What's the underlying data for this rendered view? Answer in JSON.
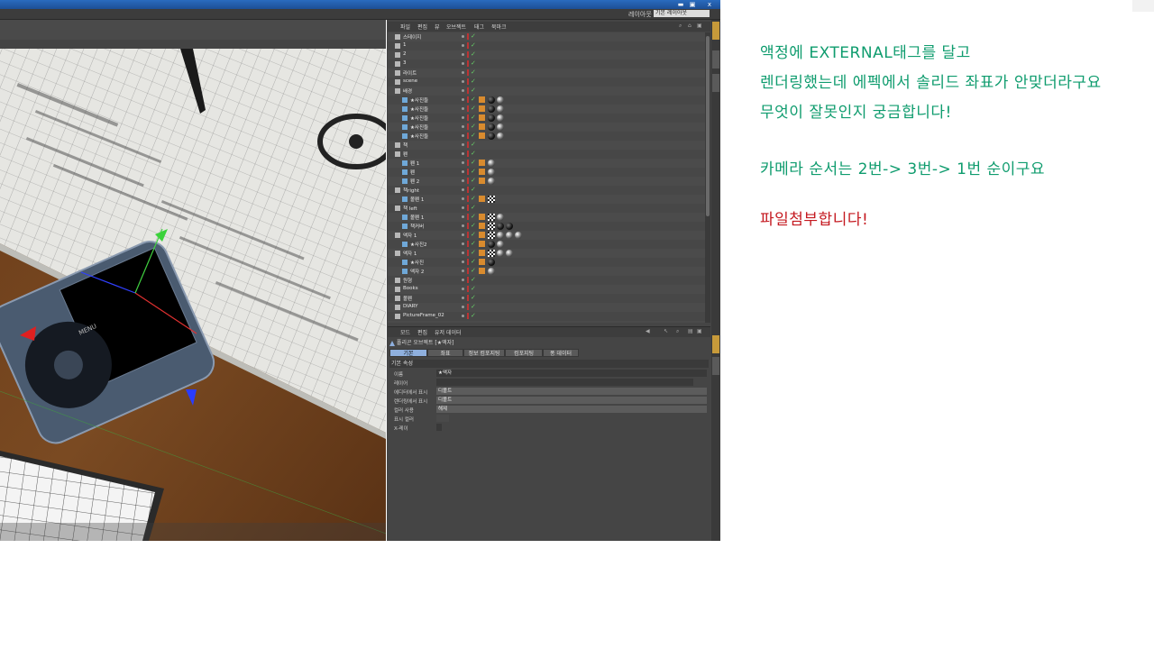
{
  "window": {
    "buttons": [
      "▬",
      "▣",
      "x"
    ],
    "layout_label": "레이아웃",
    "layout_value": "기본 레이아웃"
  },
  "viewport": {
    "device_menu_label": "MENU"
  },
  "object_manager": {
    "menu": [
      "파일",
      "편집",
      "뷰",
      "오브젝트",
      "태그",
      "북마크"
    ],
    "objects": [
      {
        "name": "스테이지",
        "indent": 0
      },
      {
        "name": "1",
        "indent": 0
      },
      {
        "name": "2",
        "indent": 0
      },
      {
        "name": "3",
        "indent": 0
      },
      {
        "name": "라이트",
        "indent": 0
      },
      {
        "name": "scene",
        "indent": 0
      },
      {
        "name": "배경",
        "indent": 0
      },
      {
        "name": "★사진들",
        "indent": 1
      },
      {
        "name": "★사진들",
        "indent": 1
      },
      {
        "name": "★사진들",
        "indent": 1
      },
      {
        "name": "★사진들",
        "indent": 1
      },
      {
        "name": "★사진들",
        "indent": 1
      },
      {
        "name": "책",
        "indent": 0
      },
      {
        "name": "펜",
        "indent": 0
      },
      {
        "name": "펜 1",
        "indent": 1
      },
      {
        "name": "펜",
        "indent": 1
      },
      {
        "name": "펜 2",
        "indent": 1
      },
      {
        "name": "책right",
        "indent": 0
      },
      {
        "name": "볼펜 1",
        "indent": 1
      },
      {
        "name": "책 left",
        "indent": 0
      },
      {
        "name": "볼펜 1",
        "indent": 1
      },
      {
        "name": "책커버",
        "indent": 1
      },
      {
        "name": "액자 1",
        "indent": 0
      },
      {
        "name": "★사진2",
        "indent": 1
      },
      {
        "name": "액자 1",
        "indent": 0
      },
      {
        "name": "★사진",
        "indent": 1
      },
      {
        "name": "액자 2",
        "indent": 1
      },
      {
        "name": "원형",
        "indent": 0
      },
      {
        "name": "Books",
        "indent": 0
      },
      {
        "name": "볼펜",
        "indent": 0
      },
      {
        "name": "DIARY",
        "indent": 0
      },
      {
        "name": "PictureFrame_02",
        "indent": 0
      }
    ]
  },
  "attribute_manager": {
    "menu": [
      "모드",
      "편집",
      "유저 데이터"
    ],
    "title": "폴리곤 오브젝트 [★액자]",
    "tabs": [
      "기본",
      "좌표",
      "퐁",
      "정보 컴포지팅",
      "컴포지팅",
      "퐁 데이터"
    ],
    "section": "기본 속성",
    "props": [
      {
        "label": "이름",
        "value": "★액자",
        "kind": "text"
      },
      {
        "label": "레이어",
        "value": "",
        "kind": "text"
      },
      {
        "label": "에디터에서 표시",
        "value": "디폴트",
        "kind": "drop"
      },
      {
        "label": "렌더링에서 표시",
        "value": "디폴트",
        "kind": "drop"
      },
      {
        "label": "컬러 사용",
        "value": "해제",
        "kind": "drop"
      },
      {
        "label": "표시 컬러",
        "value": "",
        "kind": "color"
      },
      {
        "label": "X-레이",
        "value": "",
        "kind": "check"
      }
    ]
  },
  "notes": {
    "line1": "액정에 EXTERNAL태그를 달고",
    "line2": "렌더링했는데 에펙에서 솔리드 좌표가 안맞더라구요",
    "line3": "무엇이 잘못인지 궁금합니다!",
    "line4": "카메라 순서는 2번-> 3번-> 1번 순이구요",
    "line5": "파일첨부합니다!"
  },
  "colors": {
    "note_green": "#0f9c6e",
    "note_red": "#c4181f",
    "tab_active": "#8fb0de",
    "dock_bg": "#454545"
  }
}
